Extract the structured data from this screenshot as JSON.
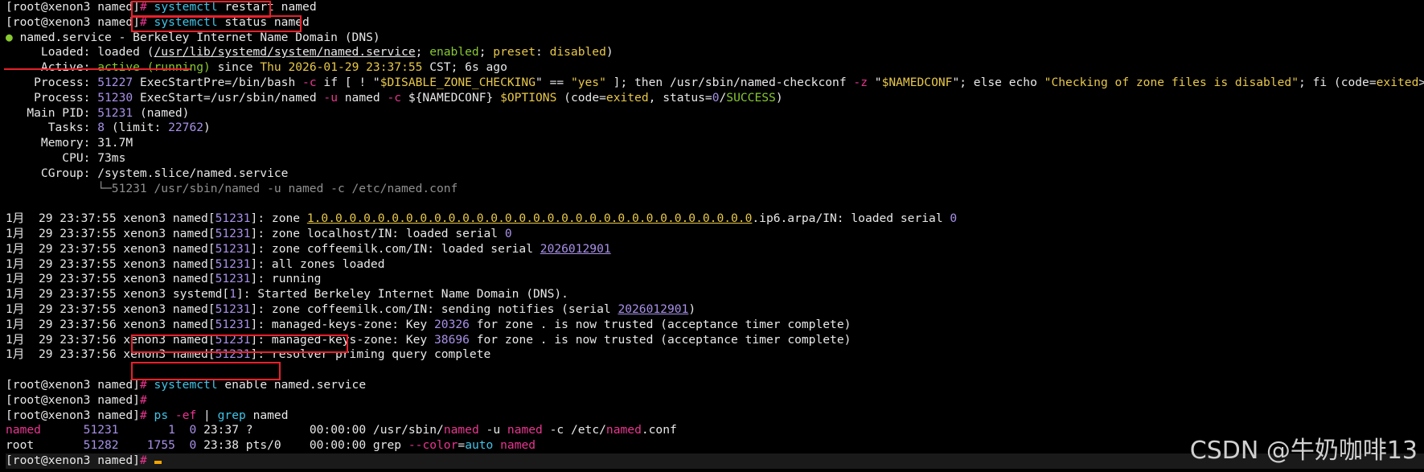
{
  "colors": {
    "bg": "#000000",
    "fg": "#e8e8e8",
    "hash": "#e8368f",
    "cmd": "#40c4e8",
    "green": "#88c830",
    "yellow": "#e8c848",
    "purple": "#a890e8",
    "gray": "#909090",
    "pink": "#e8368f",
    "red_mark": "#e8202a"
  },
  "terminal": {
    "lines": [
      {
        "segs": [
          {
            "t": "[root@xenon3 named]"
          },
          {
            "t": "#",
            "c": "hash"
          },
          {
            "t": " "
          },
          {
            "t": "systemctl",
            "c": "cmd"
          },
          {
            "t": " restart named"
          }
        ]
      },
      {
        "segs": [
          {
            "t": "[root@xenon3 named]"
          },
          {
            "t": "#",
            "c": "hash"
          },
          {
            "t": " "
          },
          {
            "t": "systemctl",
            "c": "cmd"
          },
          {
            "t": " status named"
          }
        ]
      },
      {
        "segs": [
          {
            "t": "●",
            "c": "green"
          },
          {
            "t": " named.service - Berkeley Internet Name Domain (DNS)"
          }
        ]
      },
      {
        "segs": [
          {
            "t": "     Loaded: loaded ("
          },
          {
            "t": "/usr/lib/systemd/system/named.service",
            "u": true
          },
          {
            "t": "; "
          },
          {
            "t": "enabled",
            "c": "green"
          },
          {
            "t": "; "
          },
          {
            "t": "preset",
            "c": "yellow"
          },
          {
            "t": ": "
          },
          {
            "t": "disabled",
            "c": "yellow"
          },
          {
            "t": ")"
          }
        ]
      },
      {
        "segs": [
          {
            "t": "     Active: "
          },
          {
            "t": "active (running)",
            "c": "green"
          },
          {
            "t": " since "
          },
          {
            "t": "Thu 2026-01-29 23:37:55",
            "c": "yellow"
          },
          {
            "t": " CST; 6s ago"
          }
        ]
      },
      {
        "segs": [
          {
            "t": "    Process: "
          },
          {
            "t": "51227",
            "c": "purple"
          },
          {
            "t": " ExecStartPre=/bin/bash "
          },
          {
            "t": "-c",
            "c": "pink"
          },
          {
            "t": " if [ ! \""
          },
          {
            "t": "$DISABLE_ZONE_CHECKING",
            "c": "yellow"
          },
          {
            "t": "\" == "
          },
          {
            "t": "\"yes\"",
            "c": "yellow"
          },
          {
            "t": " ]; then /usr/sbin/named-checkconf "
          },
          {
            "t": "-z",
            "c": "pink"
          },
          {
            "t": " \""
          },
          {
            "t": "$NAMEDCONF",
            "c": "yellow"
          },
          {
            "t": "\"; else echo "
          },
          {
            "t": "\"Checking of zone files is disabled\"",
            "c": "yellow"
          },
          {
            "t": "; fi (code="
          },
          {
            "t": "exited",
            "c": "yellow"
          },
          {
            "t": ">"
          }
        ]
      },
      {
        "segs": [
          {
            "t": "    Process: "
          },
          {
            "t": "51230",
            "c": "purple"
          },
          {
            "t": " ExecStart=/usr/sbin/named "
          },
          {
            "t": "-u",
            "c": "pink"
          },
          {
            "t": " named "
          },
          {
            "t": "-c",
            "c": "pink"
          },
          {
            "t": " ${NAMEDCONF} "
          },
          {
            "t": "$OPTIONS",
            "c": "yellow"
          },
          {
            "t": " (code="
          },
          {
            "t": "exited",
            "c": "yellow"
          },
          {
            "t": ", status="
          },
          {
            "t": "0",
            "c": "purple"
          },
          {
            "t": "/"
          },
          {
            "t": "SUCCESS",
            "c": "green"
          },
          {
            "t": ")"
          }
        ]
      },
      {
        "segs": [
          {
            "t": "   Main PID: "
          },
          {
            "t": "51231",
            "c": "purple"
          },
          {
            "t": " (named)"
          }
        ]
      },
      {
        "segs": [
          {
            "t": "      Tasks: "
          },
          {
            "t": "8",
            "c": "purple"
          },
          {
            "t": " (limit: "
          },
          {
            "t": "22762",
            "c": "purple"
          },
          {
            "t": ")"
          }
        ]
      },
      {
        "segs": [
          {
            "t": "     Memory: 31.7M"
          }
        ]
      },
      {
        "segs": [
          {
            "t": "        CPU: 73ms"
          }
        ]
      },
      {
        "segs": [
          {
            "t": "     CGroup: /system.slice/named.service"
          }
        ]
      },
      {
        "segs": [
          {
            "t": "             └─51231 /usr/sbin/named -u named -c /etc/named.conf",
            "c": "gray"
          }
        ]
      },
      {
        "segs": [
          {
            "t": ""
          }
        ]
      },
      {
        "segs": [
          {
            "t": "1月  29 23:37:55 xenon3 named["
          },
          {
            "t": "51231",
            "c": "purple"
          },
          {
            "t": "]: zone "
          },
          {
            "t": "1.0.0.0.0.0.0.0.0.0.0.0.0.0.0.0.0.0.0.0.0.0.0.0.0.0.0.0.0.0.0.0",
            "u": true,
            "c": "yellow"
          },
          {
            "t": ".ip6.arpa/IN: loaded serial "
          },
          {
            "t": "0",
            "c": "purple"
          }
        ]
      },
      {
        "segs": [
          {
            "t": "1月  29 23:37:55 xenon3 named["
          },
          {
            "t": "51231",
            "c": "purple"
          },
          {
            "t": "]: zone localhost/IN: loaded serial "
          },
          {
            "t": "0",
            "c": "purple"
          }
        ]
      },
      {
        "segs": [
          {
            "t": "1月  29 23:37:55 xenon3 named["
          },
          {
            "t": "51231",
            "c": "purple"
          },
          {
            "t": "]: zone coffeemilk.com/IN: loaded serial "
          },
          {
            "t": "2026012901",
            "c": "purple",
            "u": true
          }
        ]
      },
      {
        "segs": [
          {
            "t": "1月  29 23:37:55 xenon3 named["
          },
          {
            "t": "51231",
            "c": "purple"
          },
          {
            "t": "]: all zones loaded"
          }
        ]
      },
      {
        "segs": [
          {
            "t": "1月  29 23:37:55 xenon3 named["
          },
          {
            "t": "51231",
            "c": "purple"
          },
          {
            "t": "]: running"
          }
        ]
      },
      {
        "segs": [
          {
            "t": "1月  29 23:37:55 xenon3 systemd["
          },
          {
            "t": "1",
            "c": "purple"
          },
          {
            "t": "]: Started Berkeley Internet Name Domain (DNS)."
          }
        ]
      },
      {
        "segs": [
          {
            "t": "1月  29 23:37:55 xenon3 named["
          },
          {
            "t": "51231",
            "c": "purple"
          },
          {
            "t": "]: zone coffeemilk.com/IN: sending notifies (serial "
          },
          {
            "t": "2026012901",
            "c": "purple",
            "u": true
          },
          {
            "t": ")"
          }
        ]
      },
      {
        "segs": [
          {
            "t": "1月  29 23:37:56 xenon3 named["
          },
          {
            "t": "51231",
            "c": "purple"
          },
          {
            "t": "]: managed-keys-zone: Key "
          },
          {
            "t": "20326",
            "c": "purple"
          },
          {
            "t": " for zone . is now trusted (acceptance timer complete)"
          }
        ]
      },
      {
        "segs": [
          {
            "t": "1月  29 23:37:56 xenon3 named["
          },
          {
            "t": "51231",
            "c": "purple"
          },
          {
            "t": "]: managed-keys-zone: Key "
          },
          {
            "t": "38696",
            "c": "purple"
          },
          {
            "t": " for zone . is now trusted (acceptance timer complete)"
          }
        ]
      },
      {
        "segs": [
          {
            "t": "1月  29 23:37:56 xenon3 named["
          },
          {
            "t": "51231",
            "c": "purple"
          },
          {
            "t": "]: resolver priming query complete"
          }
        ]
      },
      {
        "segs": [
          {
            "t": ""
          }
        ]
      },
      {
        "segs": [
          {
            "t": "[root@xenon3 named]"
          },
          {
            "t": "#",
            "c": "hash"
          },
          {
            "t": " "
          },
          {
            "t": "systemctl",
            "c": "cmd"
          },
          {
            "t": " enable named.service"
          }
        ]
      },
      {
        "segs": [
          {
            "t": "[root@xenon3 named]"
          },
          {
            "t": "#",
            "c": "hash"
          }
        ]
      },
      {
        "segs": [
          {
            "t": "[root@xenon3 named]"
          },
          {
            "t": "#",
            "c": "hash"
          },
          {
            "t": " "
          },
          {
            "t": "ps",
            "c": "cmd"
          },
          {
            "t": " "
          },
          {
            "t": "-ef",
            "c": "pink"
          },
          {
            "t": " | "
          },
          {
            "t": "grep",
            "c": "cmd"
          },
          {
            "t": " named"
          }
        ]
      },
      {
        "segs": [
          {
            "t": "named",
            "c": "pink"
          },
          {
            "t": "      "
          },
          {
            "t": "51231",
            "c": "purple"
          },
          {
            "t": "       "
          },
          {
            "t": "1",
            "c": "purple"
          },
          {
            "t": "  "
          },
          {
            "t": "0",
            "c": "purple"
          },
          {
            "t": " 23:37 ?        00:00:00 /usr/sbin/"
          },
          {
            "t": "named",
            "c": "pink"
          },
          {
            "t": " -u "
          },
          {
            "t": "named",
            "c": "pink"
          },
          {
            "t": " -c /etc/"
          },
          {
            "t": "named",
            "c": "pink"
          },
          {
            "t": ".conf"
          }
        ]
      },
      {
        "segs": [
          {
            "t": "root       "
          },
          {
            "t": "51282",
            "c": "purple"
          },
          {
            "t": "    "
          },
          {
            "t": "1755",
            "c": "purple"
          },
          {
            "t": "  "
          },
          {
            "t": "0",
            "c": "purple"
          },
          {
            "t": " 23:38 pts/0    00:00:00 grep "
          },
          {
            "t": "--color",
            "c": "pink"
          },
          {
            "t": "="
          },
          {
            "t": "auto",
            "c": "cmd"
          },
          {
            "t": " "
          },
          {
            "t": "named",
            "c": "pink"
          }
        ]
      },
      {
        "segs": [
          {
            "t": "[root@xenon3 named]"
          },
          {
            "t": "#",
            "c": "hash"
          },
          {
            "t": " "
          }
        ],
        "cursor": true,
        "highlight": true
      }
    ]
  },
  "watermark": "CSDN @牛奶咖啡13"
}
